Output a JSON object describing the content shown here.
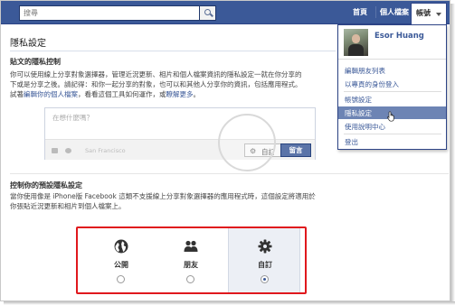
{
  "topbar": {
    "search_placeholder": "搜尋",
    "home": "首頁",
    "profile": "個人檔案",
    "account": "帳號"
  },
  "page": {
    "title": "隱私設定"
  },
  "post_privacy": {
    "heading": "貼文的隱私控制",
    "para_lines": [
      "你可以使用線上分享對象選擇器，管理近況更新、相片和個人檔案資訊的隱私設定一就在你分享的",
      "下或是分享之後。請記得：和你一起分享的對象，也可以和其他人分享你的資訊，包括應用程式。",
      "試著"
    ],
    "para_link": "編輯你的個人檔案",
    "para_mid": "，看看這個工具如何運作，或",
    "para_link2": "瞭解更多",
    "para_end": "。",
    "composer_placeholder": "在想什麼嗎？",
    "location": "San Francisco",
    "privacy_button": "自訂",
    "post_button": "留言"
  },
  "default_privacy": {
    "heading": "控制你的預設隱私設定",
    "para_lines": [
      "當你使用像是 iPhone版 Facebook 這類不支援線上分享對象選擇器的應用程式時，這個設定將適用於",
      "你張貼近況更新和相片到個人檔案上。"
    ],
    "options": [
      {
        "label": "公開",
        "icon": "globe-icon",
        "selected": false
      },
      {
        "label": "朋友",
        "icon": "friends-icon",
        "selected": false
      },
      {
        "label": "自訂",
        "icon": "gear-icon",
        "selected": true
      }
    ]
  },
  "dropdown": {
    "user_name": "Esor Huang",
    "items": [
      {
        "label": "編輯朋友列表",
        "active": false
      },
      {
        "label": "以專頁的身份登入",
        "active": false
      },
      {
        "label": "帳號設定",
        "active": false
      },
      {
        "label": "隱私設定",
        "active": true
      },
      {
        "label": "使用說明中心",
        "active": false
      },
      {
        "label": "登出",
        "active": false
      }
    ]
  },
  "colors": {
    "brand": "#3b5998",
    "highlight_border": "#e0181d",
    "active_item": "#6d84b4"
  }
}
